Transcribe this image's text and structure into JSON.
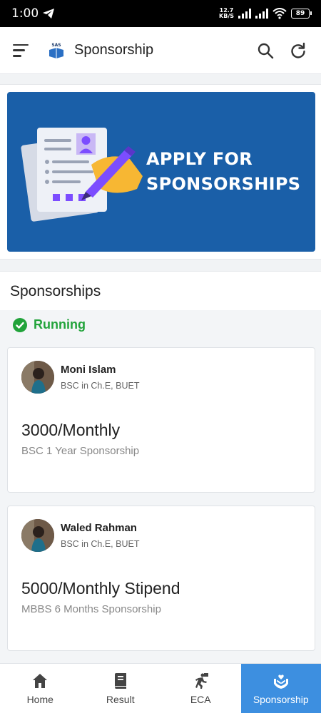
{
  "status_bar": {
    "time": "1:00",
    "net_speed_top": "12.7",
    "net_speed_bottom": "KB/S",
    "battery": "89"
  },
  "app_bar": {
    "logo_text": "SAS",
    "title": "Sponsorship"
  },
  "banner": {
    "line1": "APPLY FOR",
    "line2": "SPONSORSHIPS"
  },
  "section": {
    "title": "Sponsorships",
    "status_label": "Running",
    "status_color": "#21a33a",
    "cards": [
      {
        "name": "Moni Islam",
        "subtitle": "BSC in Ch.E, BUET",
        "amount": "3000/Monthly",
        "description": "BSC 1 Year Sponsorship"
      },
      {
        "name": "Waled Rahman",
        "subtitle": "BSC in Ch.E, BUET",
        "amount": "5000/Monthly Stipend",
        "description": "MBBS 6 Months Sponsorship"
      }
    ]
  },
  "bottom_nav": {
    "active_color": "#3d8fe0",
    "items": [
      {
        "label": "Home",
        "icon": "home-icon"
      },
      {
        "label": "Result",
        "icon": "book-icon"
      },
      {
        "label": "ECA",
        "icon": "activity-icon"
      },
      {
        "label": "Sponsorship",
        "icon": "hands-heart-icon"
      }
    ]
  }
}
